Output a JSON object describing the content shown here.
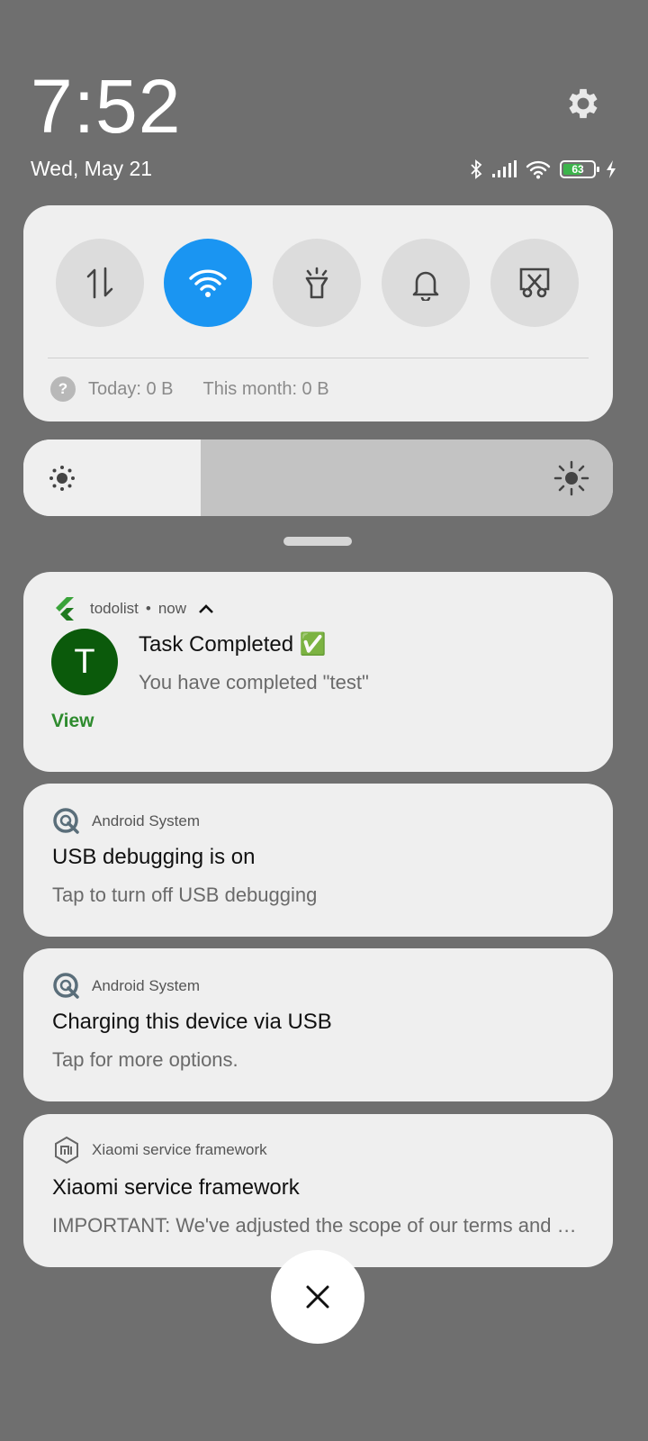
{
  "status": {
    "time": "7:52",
    "date": "Wed, May 21",
    "battery_level": "63",
    "battery_fraction": 0.63
  },
  "quick_settings": {
    "toggles": [
      {
        "name": "mobile-data-toggle",
        "icon": "data-arrows-icon",
        "active": false
      },
      {
        "name": "wifi-toggle",
        "icon": "wifi-icon",
        "active": true
      },
      {
        "name": "flashlight-toggle",
        "icon": "flashlight-icon",
        "active": false
      },
      {
        "name": "sound-toggle",
        "icon": "bell-icon",
        "active": false
      },
      {
        "name": "screenshot-toggle",
        "icon": "screenshot-icon",
        "active": false
      }
    ],
    "usage_today": "Today: 0 B",
    "usage_month": "This month: 0 B"
  },
  "brightness": {
    "level": 0.3
  },
  "notifications": [
    {
      "app": "todolist",
      "time": "now",
      "avatar_letter": "T",
      "title": "Task Completed ✅",
      "text": "You have completed \"test\"",
      "action": "View"
    },
    {
      "app": "Android System",
      "title": "USB debugging is on",
      "text": "Tap to turn off USB debugging"
    },
    {
      "app": "Android System",
      "title": "Charging this device via USB",
      "text": "Tap for more options."
    },
    {
      "app": "Xiaomi service framework",
      "title": "Xiaomi service framework",
      "text": "IMPORTANT: We've adjusted the scope of our terms and conditions"
    }
  ],
  "colors": {
    "accent_blue": "#1a95f2",
    "action_green": "#2e8b2e",
    "avatar_green": "#0b5a0b"
  }
}
